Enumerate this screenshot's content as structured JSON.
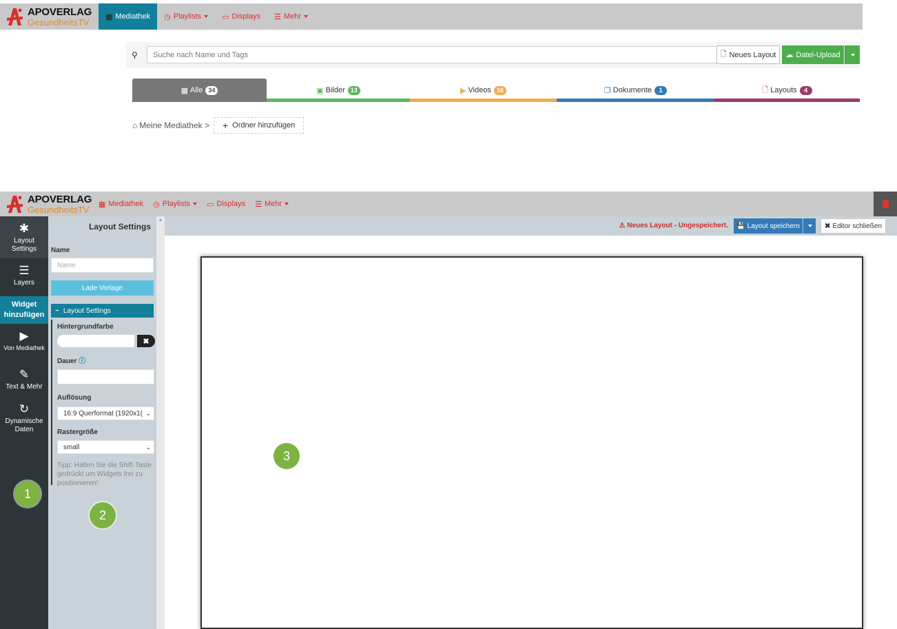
{
  "brand": {
    "name": "APOVERLAG",
    "sub": "GesundheitsTV"
  },
  "colors": {
    "accent": "#137f9b",
    "nav_link": "#d9302b",
    "upload": "#4cae4c",
    "save": "#337ab7",
    "marker": "#7cb342"
  },
  "top": {
    "nav": [
      {
        "label": "Mediathek",
        "icon": "grid-icon",
        "active": true
      },
      {
        "label": "Playlists",
        "icon": "clock-icon",
        "dropdown": true
      },
      {
        "label": "Displays",
        "icon": "monitor-icon"
      },
      {
        "label": "Mehr",
        "icon": "menu-icon",
        "dropdown": true
      }
    ],
    "search_placeholder": "Suche nach Name und Tags",
    "new_layout": "Neues Layout",
    "upload": "Datei-Upload",
    "tabs": [
      {
        "label": "Alle",
        "count": "34",
        "color": "#777777"
      },
      {
        "label": "Bilder",
        "count": "13",
        "color": "#5cb85c"
      },
      {
        "label": "Videos",
        "count": "16",
        "color": "#f0ad4e"
      },
      {
        "label": "Dokumente",
        "count": "1",
        "color": "#337ab7"
      },
      {
        "label": "Layouts",
        "count": "4",
        "color": "#9b3b6b"
      }
    ],
    "breadcrumb": "Meine Mediathek >",
    "add_folder": "Ordner hinzufügen"
  },
  "editor": {
    "nav": [
      {
        "label": "Mediathek",
        "icon": "grid-icon"
      },
      {
        "label": "Playlists",
        "icon": "clock-icon",
        "dropdown": true
      },
      {
        "label": "Displays",
        "icon": "monitor-icon"
      },
      {
        "label": "Mehr",
        "icon": "menu-icon",
        "dropdown": true
      }
    ],
    "sidebar": {
      "layout_settings": "Layout Settings",
      "layers": "Layers",
      "widget_header": "Widget hinzufügen",
      "von_mediathek": "Von Mediathek",
      "text_mehr": "Text & Mehr",
      "dynamische": "Dynamische Daten"
    },
    "settings": {
      "title": "Layout Settings",
      "name_label": "Name",
      "name_placeholder": "Name",
      "lade_vorlage": "Lade Vorlage",
      "section": "Layout Settings",
      "bg_label": "Hintergrundfarbe",
      "dauer_label": "Dauer",
      "aufloesung_label": "Auflösung",
      "aufloesung_value": "16:9 Querformat (1920x1(",
      "raster_label": "Rastergröße",
      "raster_value": "small",
      "tip": "Tipp: Halten Sie die Shift-Taste gedrückt um Widgets frei zu positionieren!"
    },
    "warning": "Neues Layout - Ungespeichert.",
    "save": "Layout speichern",
    "close": "Editor schließen",
    "markers": [
      "1",
      "2",
      "3"
    ]
  }
}
